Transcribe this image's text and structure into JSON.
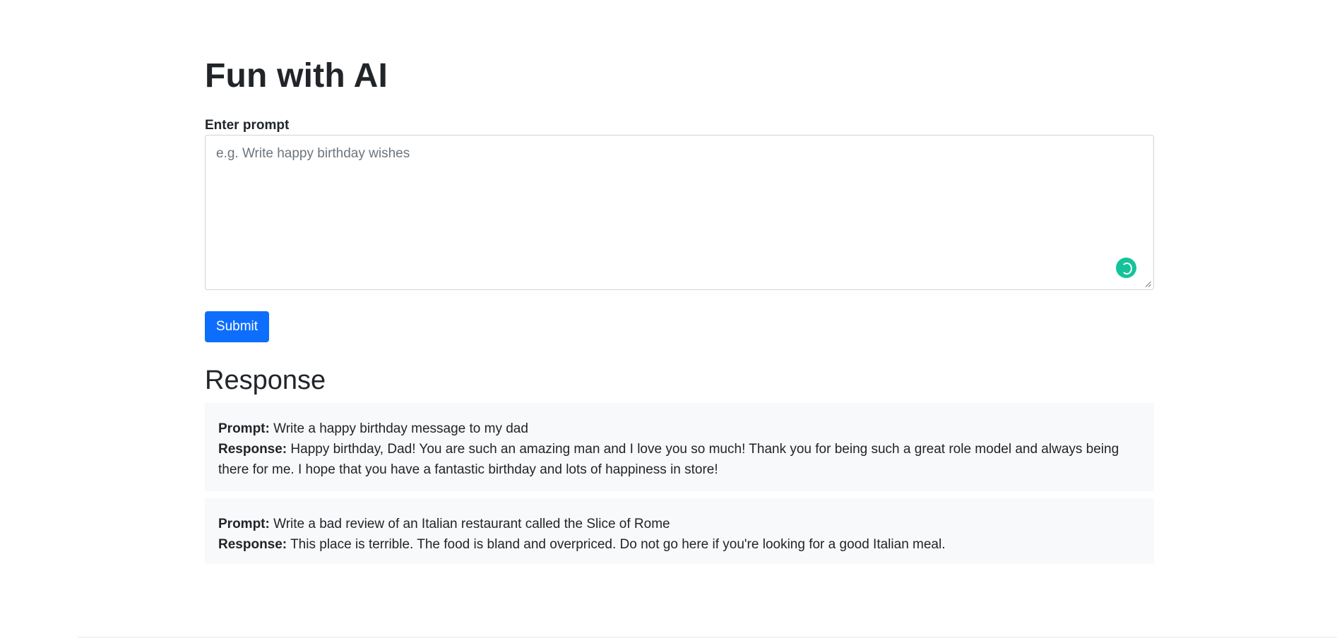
{
  "page": {
    "title": "Fun with AI"
  },
  "form": {
    "label": "Enter prompt",
    "placeholder": "e.g. Write happy birthday wishes",
    "value": "",
    "submit_label": "Submit"
  },
  "responses": {
    "heading": "Response",
    "prompt_label": "Prompt:",
    "response_label": "Response:",
    "items": [
      {
        "prompt": " Write a happy birthday message to my dad",
        "response": " Happy birthday, Dad! You are such an amazing man and I love you so much! Thank you for being such a great role model and always being there for me. I hope that you have a fantastic birthday and lots of happiness in store!"
      },
      {
        "prompt": " Write a bad review of an Italian restaurant called the Slice of Rome",
        "response": " This place is terrible. The food is bland and overpriced. Do not go here if you're looking for a good Italian meal."
      }
    ]
  },
  "icons": {
    "grammar_assistant": "grammarly-icon",
    "resize": "resize-grip-icon"
  },
  "colors": {
    "primary": "#0d6efd",
    "card_background": "#f8f9fa",
    "text": "#212529",
    "placeholder": "#6c757d",
    "assistant_badge": "#15c39a"
  }
}
